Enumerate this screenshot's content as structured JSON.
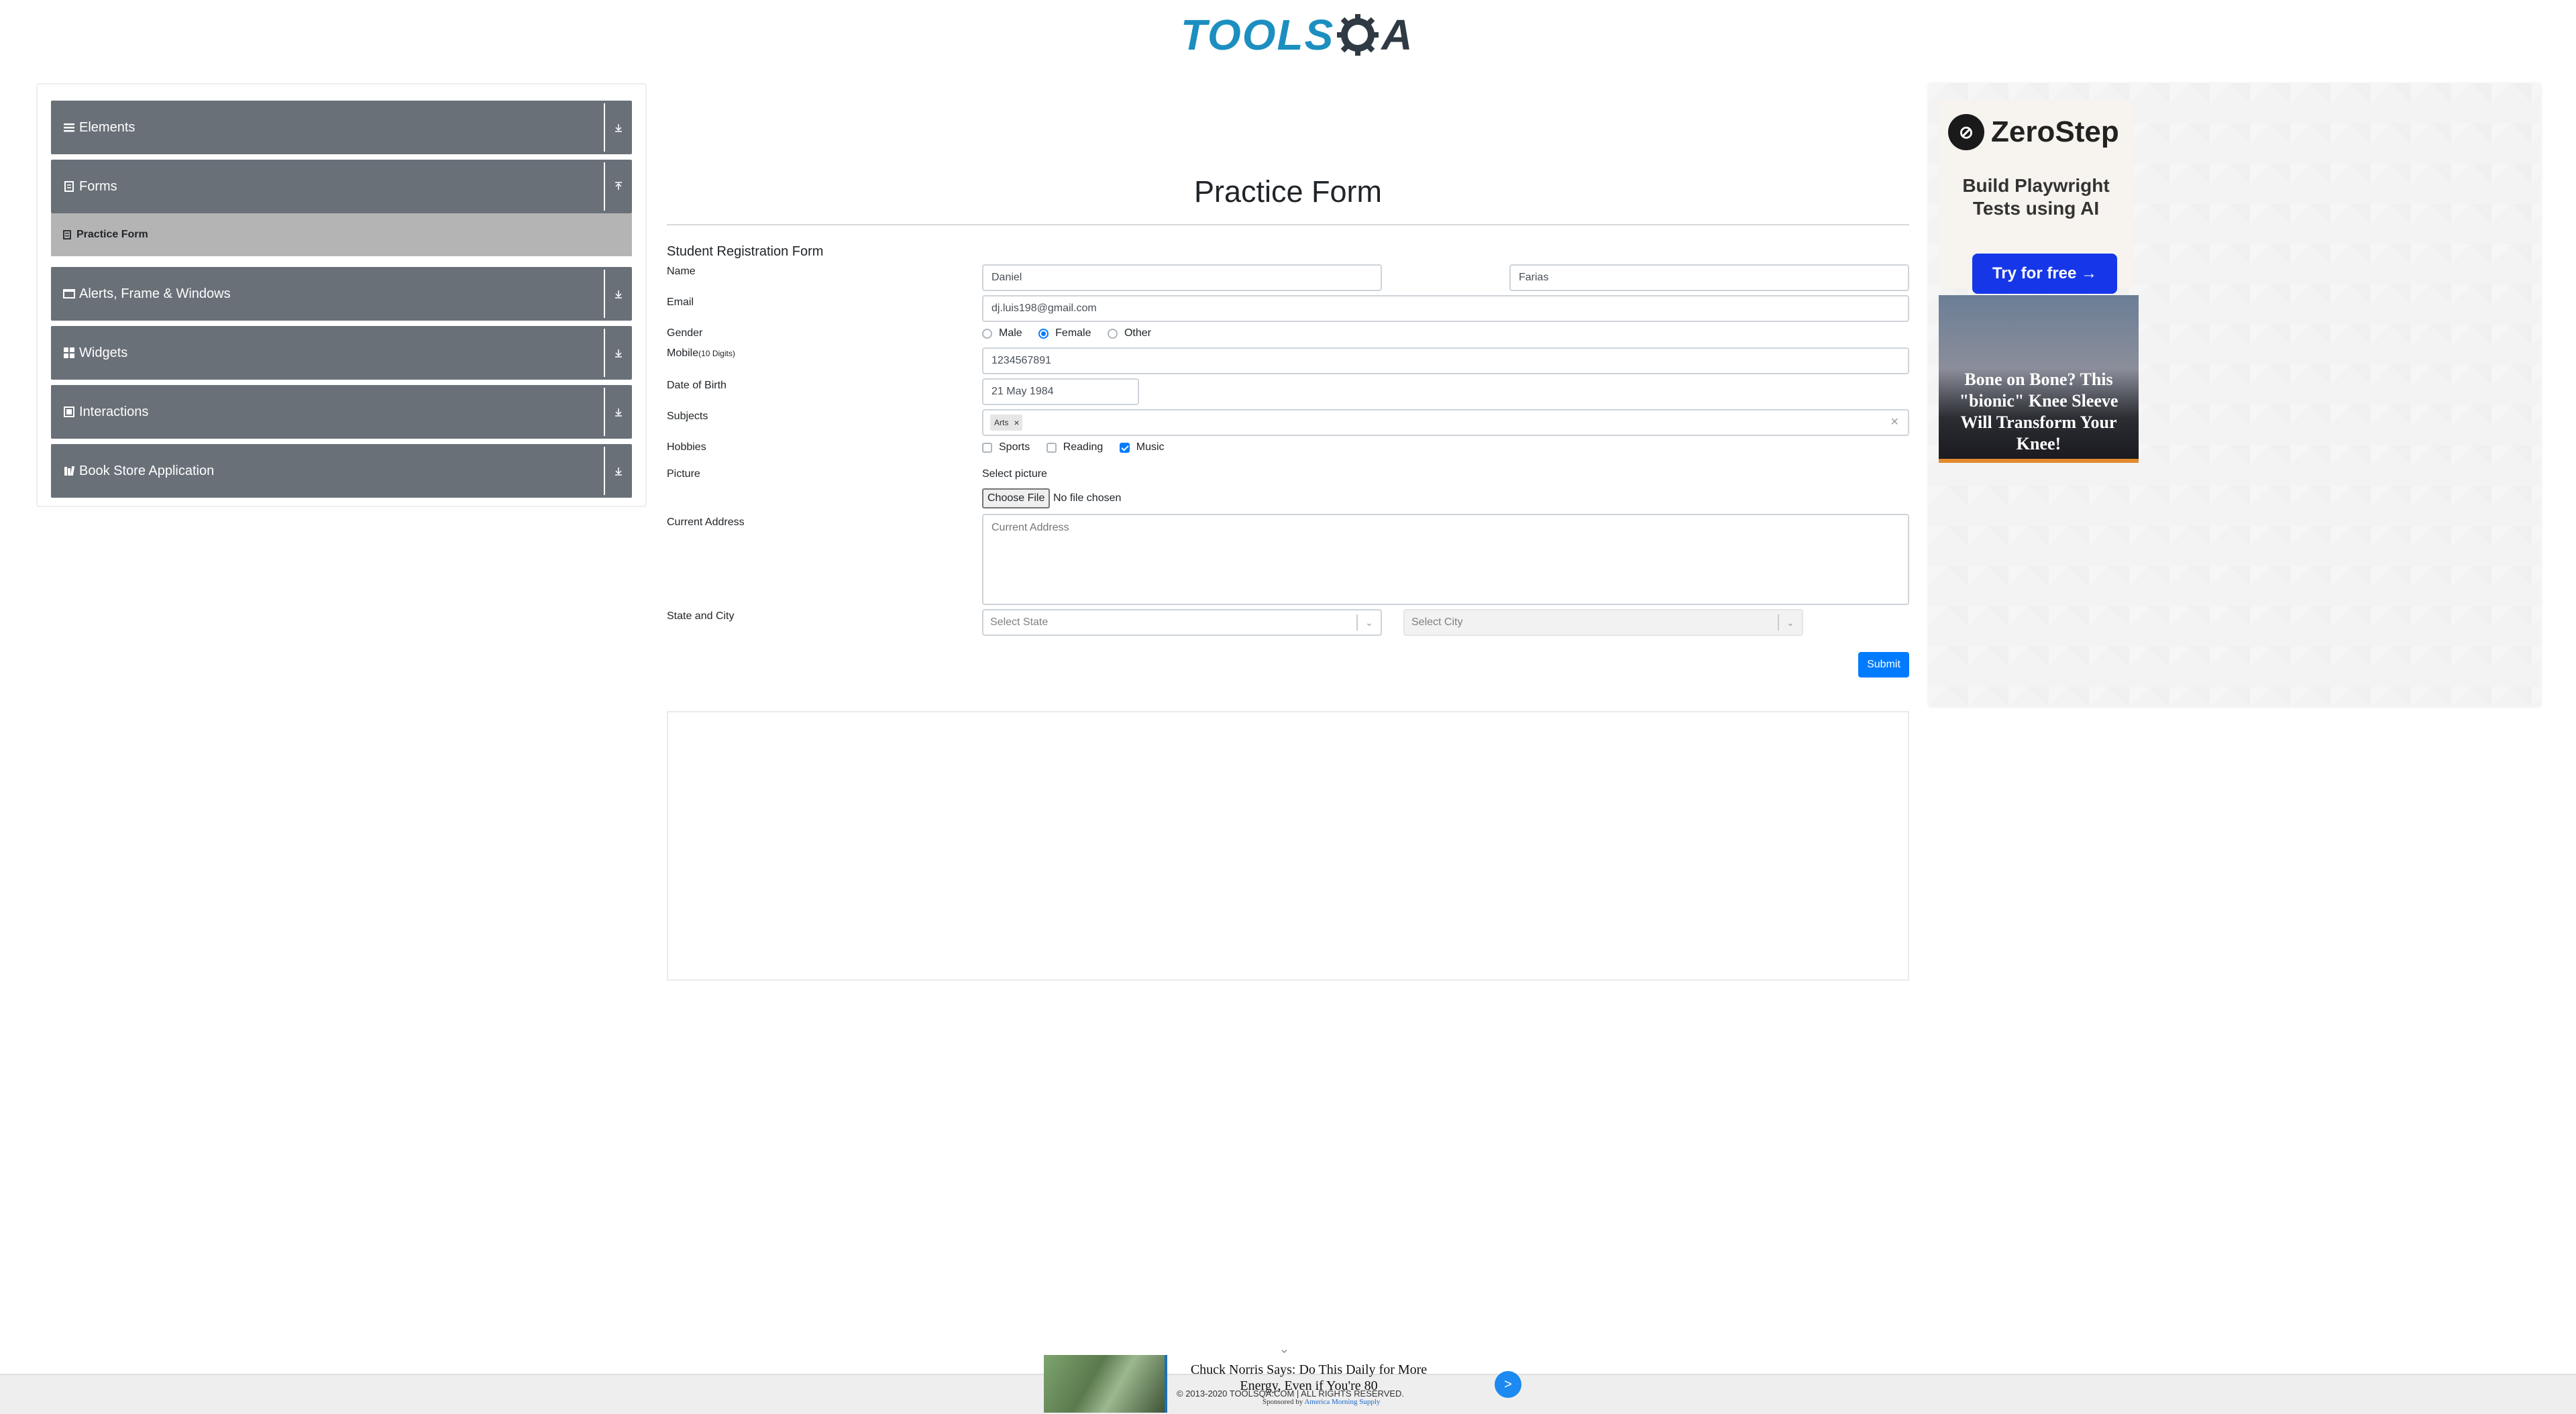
{
  "logo": {
    "text": "TOOLS",
    "suffix": "A"
  },
  "sidebar": {
    "groups": [
      {
        "label": "Elements",
        "icon": "list-icon"
      },
      {
        "label": "Forms",
        "icon": "form-icon"
      },
      {
        "label": "Alerts, Frame & Windows",
        "icon": "window-icon"
      },
      {
        "label": "Widgets",
        "icon": "widgets-icon"
      },
      {
        "label": "Interactions",
        "icon": "interactions-icon"
      },
      {
        "label": "Book Store Application",
        "icon": "bookstore-icon"
      }
    ],
    "active_item": "Practice Form"
  },
  "form": {
    "page_title": "Practice Form",
    "form_title": "Student Registration Form",
    "labels": {
      "name": "Name",
      "email": "Email",
      "gender": "Gender",
      "mobile": "Mobile",
      "mobile_hint": "(10 Digits)",
      "dob": "Date of Birth",
      "subjects": "Subjects",
      "hobbies": "Hobbies",
      "picture": "Picture",
      "address": "Current Address",
      "state_city": "State and City"
    },
    "first_name": "Daniel",
    "last_name": "Farias",
    "email": "dj.luis198@gmail.com",
    "gender_options": [
      "Male",
      "Female",
      "Other"
    ],
    "gender_selected": "Female",
    "mobile": "1234567891",
    "dob": "21 May 1984",
    "subjects": [
      "Arts"
    ],
    "hobbies": [
      {
        "label": "Sports",
        "checked": false
      },
      {
        "label": "Reading",
        "checked": false
      },
      {
        "label": "Music",
        "checked": true
      }
    ],
    "picture_label": "Select picture",
    "file_button": "Choose File",
    "file_status": "No file chosen",
    "address_placeholder": "Current Address",
    "state_placeholder": "Select State",
    "city_placeholder": "Select City",
    "submit_label": "Submit"
  },
  "right_ad": {
    "brand": "ZeroStep",
    "tagline": "Build Playwright Tests using AI",
    "cta": "Try for free →",
    "promo": "Bone on Bone? This \"bionic\" Knee Sleeve Will Transform Your Knee!"
  },
  "bottom_ad": {
    "headline": "Chuck Norris Says: Do This Daily for More Energy, Even if You're 80",
    "sponsored_prefix": "Sponsored by",
    "sponsor": "America Morning Supply",
    "go": ">"
  },
  "footer": {
    "copyright": "© 2013-2020 TOOLSQA.COM | ALL RIGHTS RESERVED."
  },
  "colors": {
    "accent": "#007bff",
    "sidebar": "#697078",
    "logo": "#1c8fc0"
  }
}
